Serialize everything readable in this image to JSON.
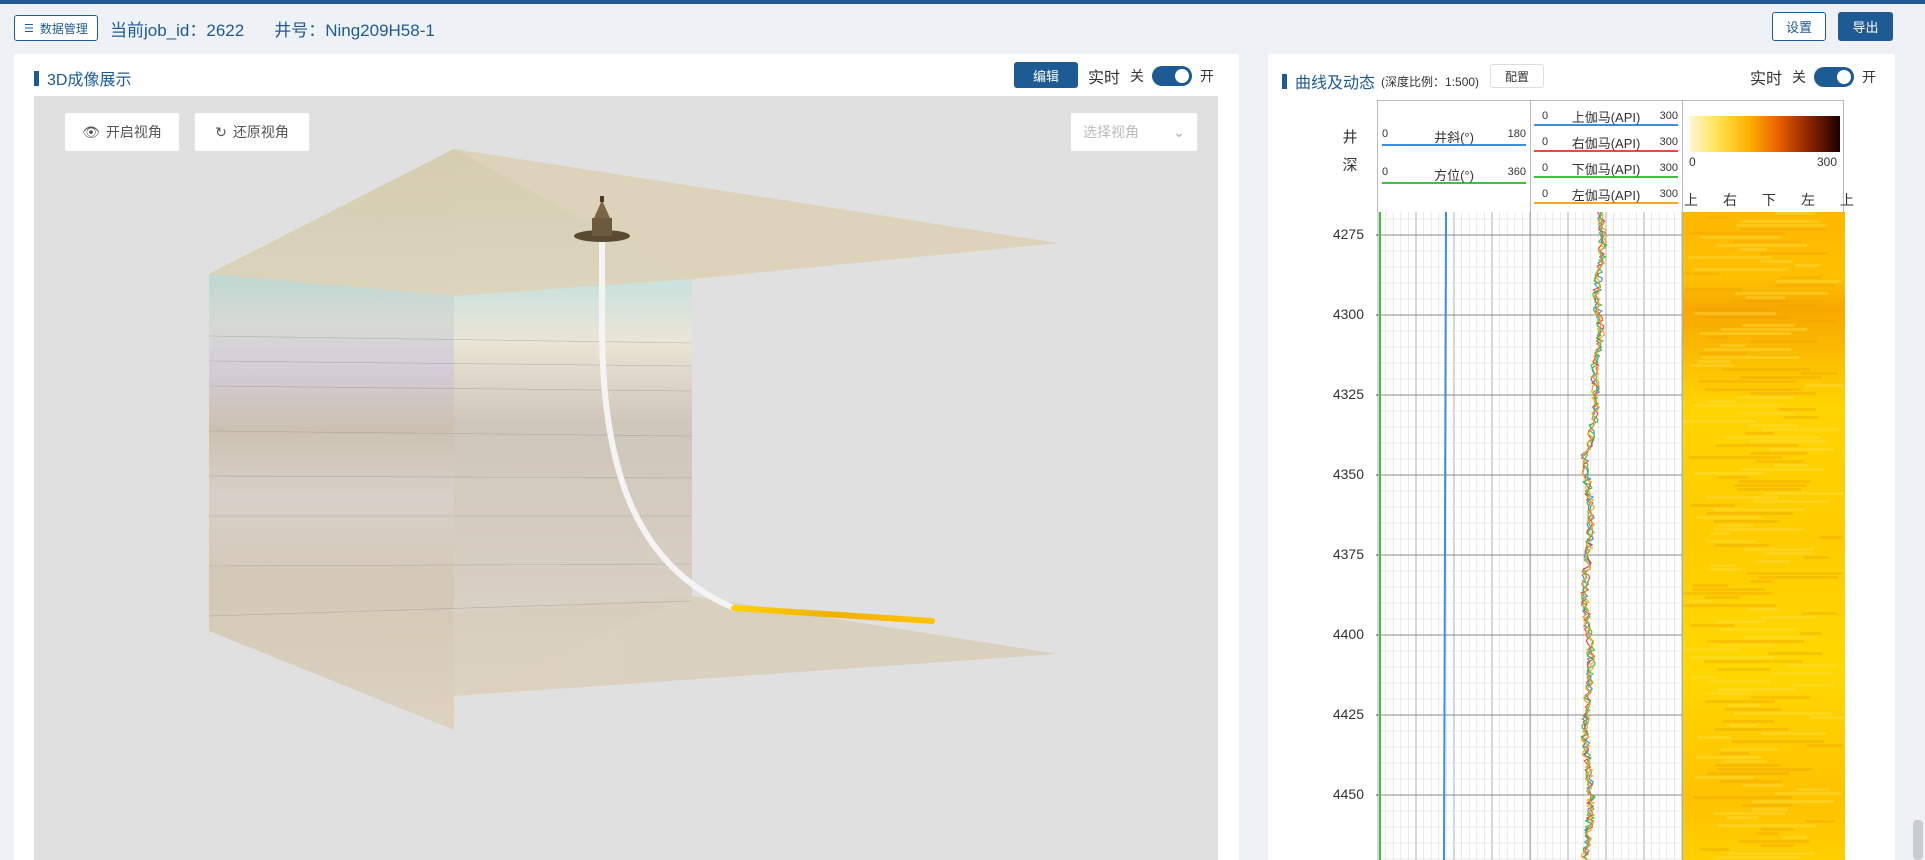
{
  "header": {
    "data_mgmt_label": "数据管理",
    "job_id_text": "当前job_id：2622",
    "well_text": "井号：Ning209H58-1",
    "settings_label": "设置",
    "export_label": "导出"
  },
  "panel3d": {
    "title": "3D成像展示",
    "edit_label": "编辑",
    "realtime_label": "实时",
    "off_label": "关",
    "on_label": "开",
    "open_view_label": "开启视角",
    "reset_view_label": "还原视角",
    "select_view_placeholder": "选择视角"
  },
  "curve": {
    "title": "曲线及动态",
    "scale_text": "(深度比例：1:500)",
    "config_label": "配置",
    "realtime_label": "实时",
    "off_label": "关",
    "on_label": "开",
    "depth_header_top": "井",
    "depth_header_bottom": "深",
    "track1": [
      {
        "name": "井斜(°)",
        "min": "0",
        "max": "180",
        "color": "#3a8ee6"
      },
      {
        "name": "方位(°)",
        "min": "0",
        "max": "360",
        "color": "#3ec13e"
      }
    ],
    "track2": [
      {
        "name": "上伽马(API)",
        "min": "0",
        "max": "300",
        "color": "#3a8ee6"
      },
      {
        "name": "右伽马(API)",
        "min": "0",
        "max": "300",
        "color": "#e74c3c"
      },
      {
        "name": "下伽马(API)",
        "min": "0",
        "max": "300",
        "color": "#3ec13e"
      },
      {
        "name": "左伽马(API)",
        "min": "0",
        "max": "300",
        "color": "#f5a623"
      }
    ],
    "image_scale": {
      "min": "0",
      "max": "300"
    },
    "orient_labels": [
      "上",
      "右",
      "下",
      "左",
      "上"
    ],
    "depths": [
      "4275",
      "4300",
      "4325",
      "4350",
      "4375",
      "4400",
      "4425",
      "4450"
    ]
  }
}
